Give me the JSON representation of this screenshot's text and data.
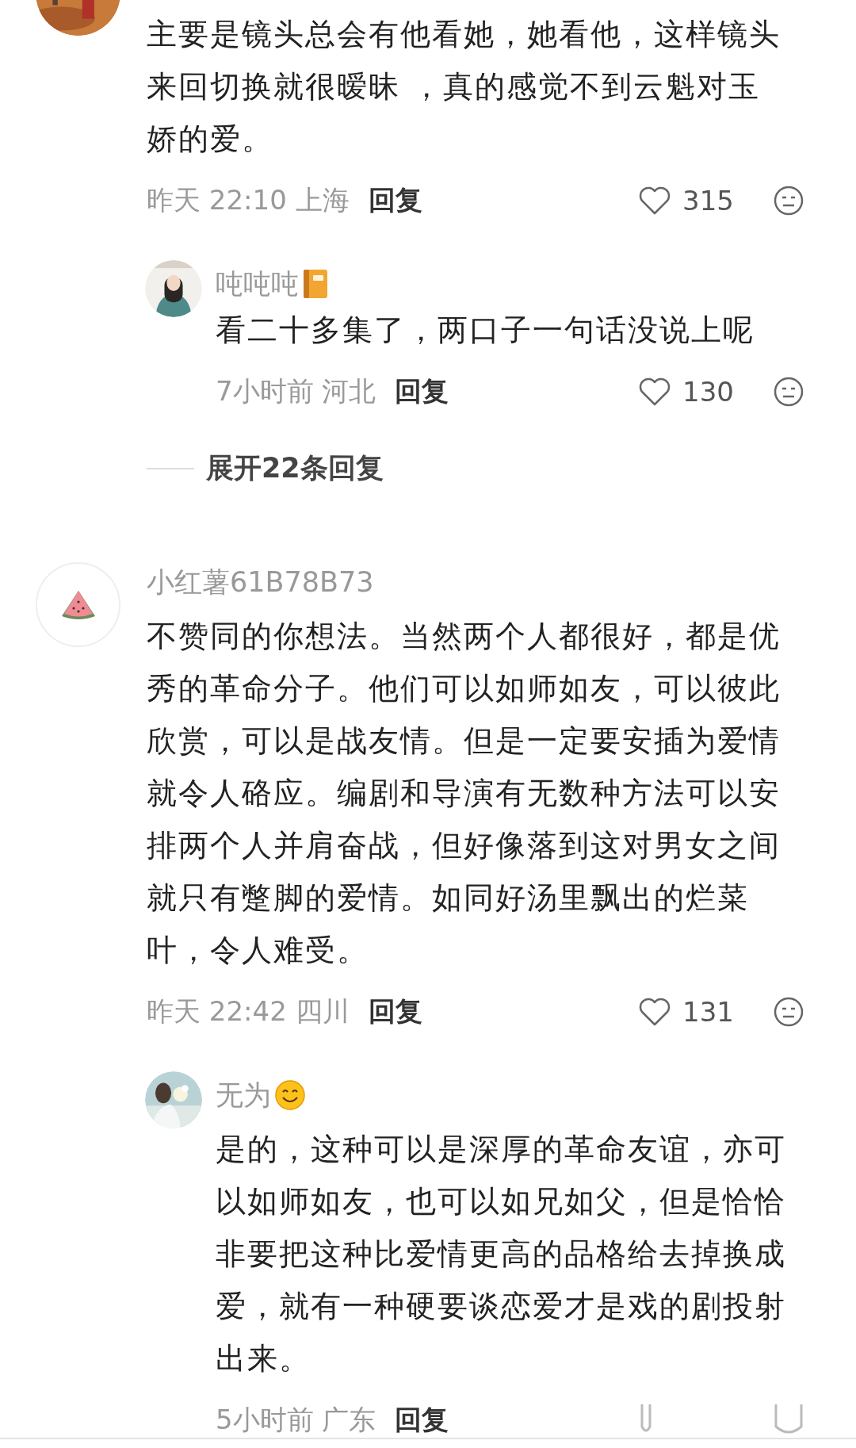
{
  "comments": [
    {
      "avatar": {
        "kind": "picture"
      },
      "text": "主要是镜头总会有他看她，她看他，这样镜头来回切换就很暧昧 ，真的感觉不到云魁对玉娇的爱。",
      "time": "昨天 22:10 上海",
      "reply": "回复",
      "likes": "315",
      "replies": [
        {
          "avatar": {
            "kind": "picture"
          },
          "name": "吨吨吨",
          "badge": {
            "kind": "notebook"
          },
          "text": "看二十多集了，两口子一句话没说上呢",
          "time": "7小时前 河北",
          "reply": "回复",
          "likes": "130"
        }
      ],
      "expand": "展开22条回复"
    },
    {
      "avatar": {
        "kind": "icon"
      },
      "name": "小红薯61B78B73",
      "text": "不赞同的你想法。当然两个人都很好，都是优秀的革命分子。他们可以如师如友，可以彼此欣赏，可以是战友情。但是一定要安插为爱情就令人硌应。编剧和导演有无数种方法可以安排两个人并肩奋战，但好像落到这对男女之间就只有蹩脚的爱情。如同好汤里飘出的烂菜叶，令人难受。",
      "time": "昨天 22:42 四川",
      "reply": "回复",
      "likes": "131",
      "replies": [
        {
          "avatar": {
            "kind": "picture"
          },
          "name": "无为",
          "badge": {
            "kind": "smile"
          },
          "text": "是的，这种可以是深厚的革命友谊，亦可以如师如友，也可以如兄如父，但是恰恰非要把这种比爱情更高的品格给去掉换成爱，就有一种硬要谈恋爱才是戏的剧投射出来。",
          "time": "5小时前 广东",
          "reply": "回复"
        }
      ]
    }
  ]
}
